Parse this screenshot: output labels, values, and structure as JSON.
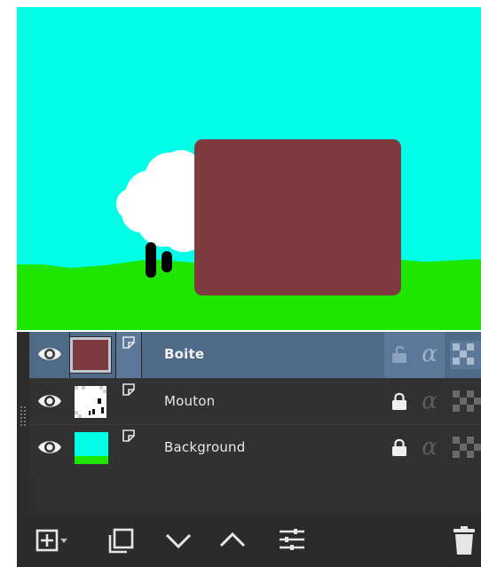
{
  "canvas": {
    "sky_color": "#00ffe6",
    "grass_color": "#1ee600",
    "box_color": "#7e3b3d",
    "sheep_color": "#ffffff",
    "legs_color": "#000000"
  },
  "layers": [
    {
      "name": "Boite",
      "selected": true,
      "visible": true,
      "locked": false,
      "thumb_color": "#7e3b3d"
    },
    {
      "name": "Mouton",
      "selected": false,
      "visible": true,
      "locked": true,
      "thumb_color": "#ffffff"
    },
    {
      "name": "Background",
      "selected": false,
      "visible": true,
      "locked": true,
      "thumb_color": "#00ffe6"
    }
  ],
  "toolbar": {
    "buttons": [
      "add-layer-icon",
      "dropdown-icon",
      "duplicate-layer-icon",
      "move-down-icon",
      "move-up-icon",
      "layer-properties-icon",
      "delete-layer-icon"
    ]
  },
  "colors": {
    "panel_bg": "#313131",
    "selected_row": "#4f6a87",
    "text": "#e8e8e8",
    "icon": "#e6e6e6"
  }
}
